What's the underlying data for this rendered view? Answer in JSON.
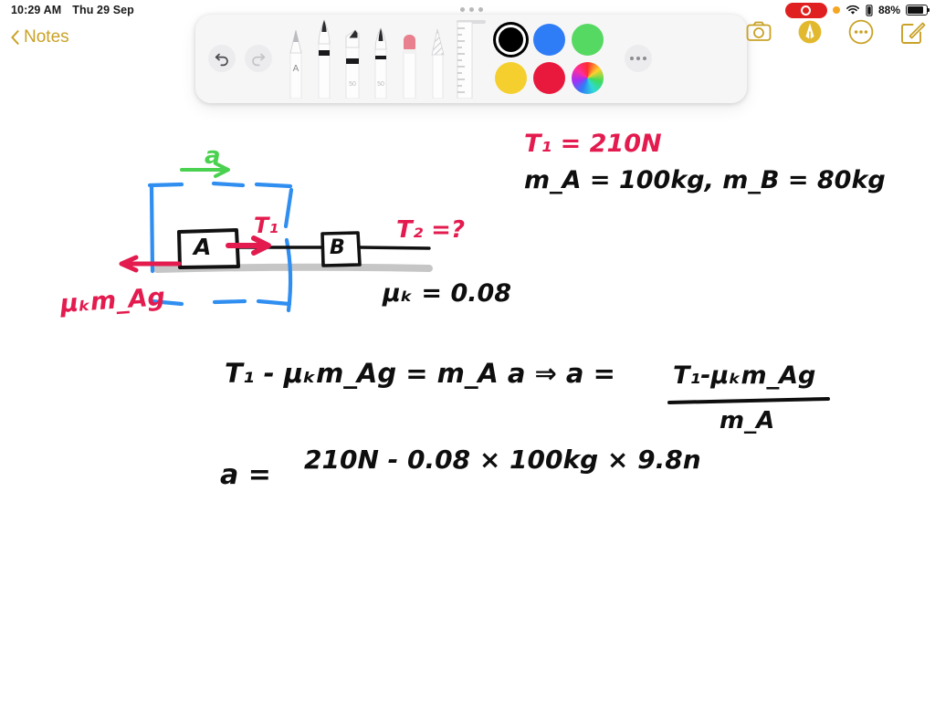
{
  "status_bar": {
    "time": "10:29 AM",
    "date": "Thu 29 Sep",
    "battery_percent": "88%",
    "icons": [
      "recording-pill",
      "orange-dot",
      "wifi-icon",
      "battery-small-icon",
      "battery-icon"
    ]
  },
  "nav": {
    "back_label": "Notes",
    "back_icon": "chevron-left-icon",
    "accent_color": "#c9a227"
  },
  "top_right_toolbar": {
    "items": [
      {
        "name": "camera-icon",
        "label": "Camera"
      },
      {
        "name": "markup-icon",
        "label": "Markup"
      },
      {
        "name": "more-icon",
        "label": "More"
      },
      {
        "name": "compose-icon",
        "label": "Compose"
      }
    ]
  },
  "markup_palette": {
    "undo_label": "Undo",
    "redo_label": "Redo",
    "more_label": "More",
    "tools": [
      {
        "name": "pencil-tool",
        "label": "Pencil",
        "badge": "A"
      },
      {
        "name": "pen-tool",
        "label": "Pen",
        "badge": ""
      },
      {
        "name": "highlighter-tool",
        "label": "Highlighter",
        "badge": "50"
      },
      {
        "name": "brush-tool",
        "label": "Brush",
        "badge": "50"
      },
      {
        "name": "eraser-tool",
        "label": "Eraser",
        "badge": ""
      },
      {
        "name": "smudge-tool",
        "label": "Smudge",
        "badge": ""
      },
      {
        "name": "ruler-tool",
        "label": "Ruler",
        "badge": ""
      }
    ],
    "colors": [
      {
        "name": "black",
        "hex": "#000000",
        "selected": true
      },
      {
        "name": "blue",
        "hex": "#2f7df6",
        "selected": false
      },
      {
        "name": "green",
        "hex": "#56d963",
        "selected": false
      },
      {
        "name": "yellow",
        "hex": "#f5cf2e",
        "selected": false
      },
      {
        "name": "red",
        "hex": "#e8193c",
        "selected": false
      },
      {
        "name": "color-wheel",
        "hex": "",
        "selected": false
      }
    ]
  },
  "note": {
    "ink_colors": {
      "black": "#0e0e0e",
      "crimson": "#e31b4e",
      "blue": "#2f8ef0",
      "green": "#4ad14f",
      "gray": "#c4c4c4"
    },
    "handwriting": {
      "accel_label": "a",
      "block_a_label": "A",
      "block_b_label": "B",
      "tension1_label": "T₁",
      "tension2_question": "T₂ =?",
      "friction_label": "μₖm_Ag",
      "given_tension": "T₁ = 210N",
      "given_masses": "m_A = 100kg,   m_B = 80kg",
      "given_mu": "μₖ = 0.08",
      "equation_line": "T₁ - μₖm_Ag = m_A a   ⇒   a =",
      "fraction_numerator": "T₁-μₖm_Ag",
      "fraction_denominator": "m_A",
      "substitution_lhs": "a =",
      "substitution_rhs": "210N - 0.08 × 100kg × 9.8n"
    }
  }
}
